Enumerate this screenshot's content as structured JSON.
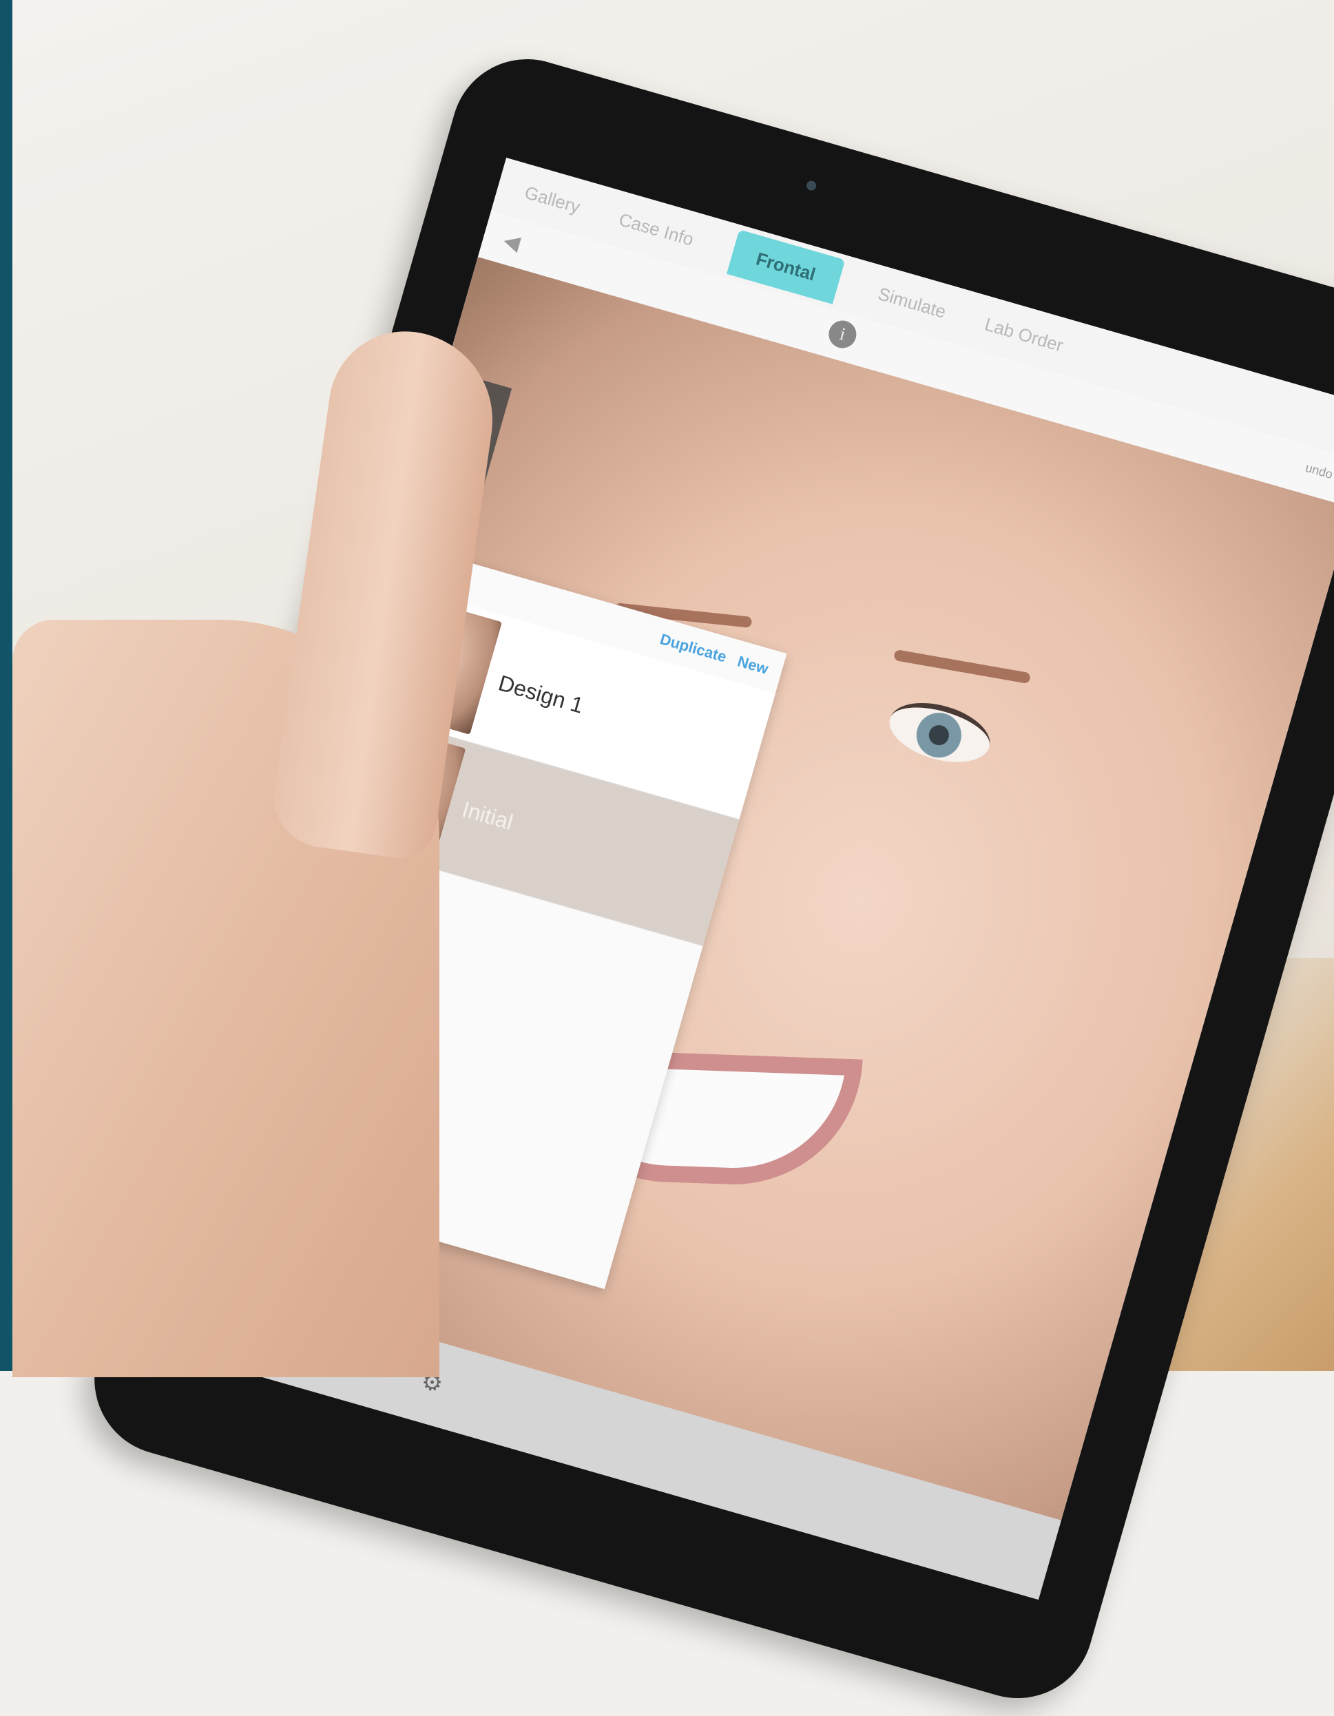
{
  "tabs": [
    {
      "label": "Gallery",
      "active": false
    },
    {
      "label": "Case Info",
      "active": false
    },
    {
      "label": "Frontal",
      "active": true
    },
    {
      "label": "Simulate",
      "active": false
    },
    {
      "label": "Lab Order",
      "active": false
    }
  ],
  "subbar": {
    "undo_label": "undo"
  },
  "panel": {
    "duplicate_label": "Duplicate",
    "new_label": "New",
    "designs": [
      {
        "name": "Design 1",
        "selected": true
      },
      {
        "name": "Initial",
        "selected": false
      }
    ]
  },
  "icons": [
    "back-icon",
    "info-icon",
    "trash-icon",
    "text-size-icon",
    "zoom-icon",
    "share-icon",
    "settings-icon"
  ],
  "colors": {
    "accent_tab": "#6fd6dc",
    "link_blue": "#4aa3df",
    "frame": "#115468"
  }
}
